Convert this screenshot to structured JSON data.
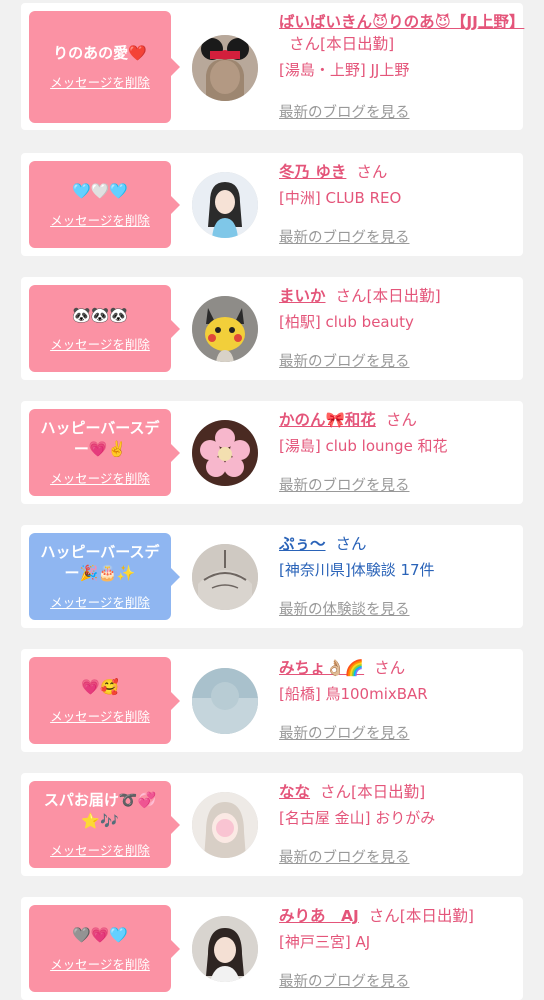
{
  "delete_label": "メッセージを削除",
  "colors": {
    "pink_bubble": "#fb92a4",
    "blue_bubble": "#8fb6f1",
    "name_pink": "#e4557a",
    "name_blue": "#2a63b8",
    "link_gray": "#999999"
  },
  "items": [
    {
      "message": "りのあの愛❤️",
      "name": "ばいばいきん😈りのあ😈【JJ上野】",
      "san": "さん",
      "status": "[本日出勤]",
      "shop": "[湯島・上野] JJ上野",
      "link": "最新のブログを見る"
    },
    {
      "message": "🩵🤍🩵",
      "name": "冬乃 ゆき",
      "san": "さん",
      "status": "",
      "shop": "[中洲] CLUB REO",
      "link": "最新のブログを見る"
    },
    {
      "message": "🐼🐼🐼",
      "name": "まいか",
      "san": "さん",
      "status": "[本日出勤]",
      "shop": "[柏駅] club beauty",
      "link": "最新のブログを見る"
    },
    {
      "message": "ハッピーバースデー💗✌️",
      "name": "かのん🎀和花",
      "san": "さん",
      "status": "",
      "shop": "[湯島] club lounge 和花",
      "link": "最新のブログを見る"
    },
    {
      "message": "ハッピーバースデー🎉🎂✨",
      "name": "ぷぅ〜",
      "san": "さん",
      "status": "",
      "shop": "[神奈川県]体験談 17件",
      "link": "最新の体験談を見る"
    },
    {
      "message": "💗🥰",
      "name": "みちょ👌🏼🌈",
      "san": "さん",
      "status": "",
      "shop": "[船橋] 鳥100mixBAR",
      "link": "最新のブログを見る"
    },
    {
      "message": "スパお届け➰💞⭐️🎶",
      "name": "なな",
      "san": "さん",
      "status": "[本日出勤]",
      "shop": "[名古屋 金山] おりがみ",
      "link": "最新のブログを見る"
    },
    {
      "message": "🩶💗🩵",
      "name": "みりあ　AJ",
      "san": "さん",
      "status": "[本日出勤]",
      "shop": "[神戸三宮] AJ",
      "link": "最新のブログを見る"
    }
  ]
}
